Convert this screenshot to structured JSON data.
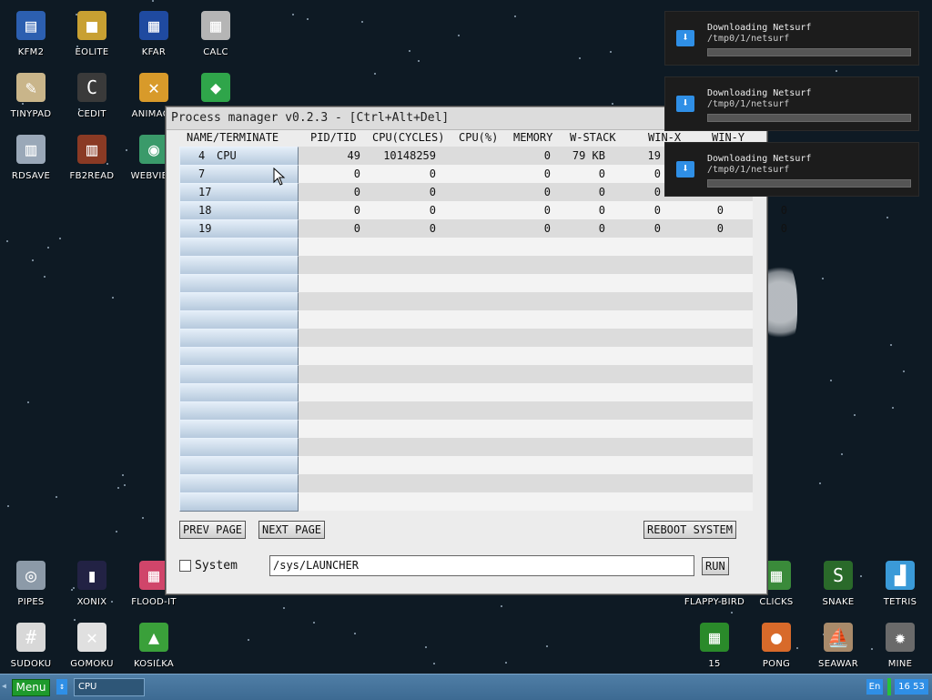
{
  "desktop": {
    "icons_left": [
      {
        "label": "KFM2",
        "icon": "floppy-icon",
        "glyph": "▤",
        "color": "#2c5fb0"
      },
      {
        "label": "EOLITE",
        "icon": "folder-icon",
        "glyph": "■",
        "color": "#c8a032"
      },
      {
        "label": "KFAR",
        "icon": "kfar-icon",
        "glyph": "▦",
        "color": "#1f4aa0"
      },
      {
        "label": "CALC",
        "icon": "calculator-icon",
        "glyph": "▦",
        "color": "#b5b5b5"
      },
      {
        "label": "TINYPAD",
        "icon": "notepad-icon",
        "glyph": "✎",
        "color": "#c9b58a"
      },
      {
        "label": "CEDIT",
        "icon": "code-editor-icon",
        "glyph": "C",
        "color": "#3a3a3a"
      },
      {
        "label": "ANIMAGE",
        "icon": "paint-icon",
        "glyph": "✕",
        "color": "#d89a2a"
      },
      {
        "label": "",
        "icon": "cube-icon",
        "glyph": "◆",
        "color": "#2fa54a"
      },
      {
        "label": "RDSAVE",
        "icon": "rdsave-icon",
        "glyph": "▥",
        "color": "#9aa8b8"
      },
      {
        "label": "FB2READ",
        "icon": "book-icon",
        "glyph": "▥",
        "color": "#8a3a24"
      },
      {
        "label": "WEBVIEW",
        "icon": "browser-icon",
        "glyph": "◉",
        "color": "#3a9a6a"
      }
    ],
    "icons_bottom_left": [
      {
        "label": "PIPES",
        "icon": "pipes-icon",
        "glyph": "◎",
        "color": "#8c9aa8"
      },
      {
        "label": "XONIX",
        "icon": "xonix-icon",
        "glyph": "▮",
        "color": "#222244"
      },
      {
        "label": "FLOOD-IT",
        "icon": "flood-it-icon",
        "glyph": "▦",
        "color": "#d0456a"
      },
      {
        "label": "SUDOKU",
        "icon": "sudoku-icon",
        "glyph": "#",
        "color": "#d8d8d8"
      },
      {
        "label": "GOMOKU",
        "icon": "gomoku-icon",
        "glyph": "✕",
        "color": "#e0e0e0"
      },
      {
        "label": "KOSILKA",
        "icon": "lawnmower-icon",
        "glyph": "▲",
        "color": "#3aa03a"
      }
    ],
    "icons_bottom_right": [
      {
        "label": "FLAPPY-BIRD",
        "icon": "flappy-bird-icon",
        "glyph": "",
        "color": "#0e1a24"
      },
      {
        "label": "CLICKS",
        "icon": "clicks-icon",
        "glyph": "▦",
        "color": "#3a8a3a"
      },
      {
        "label": "SNAKE",
        "icon": "snake-icon",
        "glyph": "S",
        "color": "#2a6a2a"
      },
      {
        "label": "TETRIS",
        "icon": "tetris-icon",
        "glyph": "▟",
        "color": "#3a9ad8"
      },
      {
        "label": "15",
        "icon": "fifteen-puzzle-icon",
        "glyph": "▦",
        "color": "#2a8a2a"
      },
      {
        "label": "PONG",
        "icon": "pong-icon",
        "glyph": "●",
        "color": "#d86a2a"
      },
      {
        "label": "SEAWAR",
        "icon": "ship-icon",
        "glyph": "⛵",
        "color": "#a88a6a"
      },
      {
        "label": "MINE",
        "icon": "mine-icon",
        "glyph": "✹",
        "color": "#6a6a6a"
      }
    ]
  },
  "window": {
    "title": "Process manager v0.2.3 - [Ctrl+Alt+Del]",
    "columns": [
      "NAME/TERMINATE",
      "PID/TID",
      "CPU(CYCLES)",
      "CPU(%)",
      "MEMORY",
      "W-STACK",
      "WIN-X",
      "WIN-Y"
    ],
    "processes": [
      {
        "slot": "4",
        "name": "CPU",
        "pid": "49",
        "cycles": "10148259",
        "pct": "0",
        "mem": "79 KB",
        "wstack": "19",
        "winx": "",
        "winy": ""
      },
      {
        "slot": "7",
        "name": "",
        "pid": "0",
        "cycles": "0",
        "pct": "0",
        "mem": "0",
        "wstack": "0",
        "winx": "",
        "winy": ""
      },
      {
        "slot": "17",
        "name": "",
        "pid": "0",
        "cycles": "0",
        "pct": "0",
        "mem": "0",
        "wstack": "0",
        "winx": "",
        "winy": ""
      },
      {
        "slot": "18",
        "name": "",
        "pid": "0",
        "cycles": "0",
        "pct": "0",
        "mem": "0",
        "wstack": "0",
        "winx": "0",
        "winy": "0"
      },
      {
        "slot": "19",
        "name": "",
        "pid": "0",
        "cycles": "0",
        "pct": "0",
        "mem": "0",
        "wstack": "0",
        "winx": "0",
        "winy": "0"
      }
    ],
    "empty_rows": 15,
    "prev_page": "PREV PAGE",
    "next_page": "NEXT PAGE",
    "reboot": "REBOOT SYSTEM",
    "system_label": "System",
    "system_checked": false,
    "run_input": "/sys/LAUNCHER",
    "run_button": "RUN"
  },
  "notifications": [
    {
      "title": "Downloading Netsurf",
      "path": "/tmp0/1/netsurf",
      "progress": 0
    },
    {
      "title": "Downloading Netsurf",
      "path": "/tmp0/1/netsurf",
      "progress": 0
    },
    {
      "title": "Downloading Netsurf",
      "path": "/tmp0/1/netsurf",
      "progress": 0
    }
  ],
  "taskbar": {
    "menu": "Menu",
    "task": "CPU",
    "lang": "En",
    "clock": "16 53"
  }
}
